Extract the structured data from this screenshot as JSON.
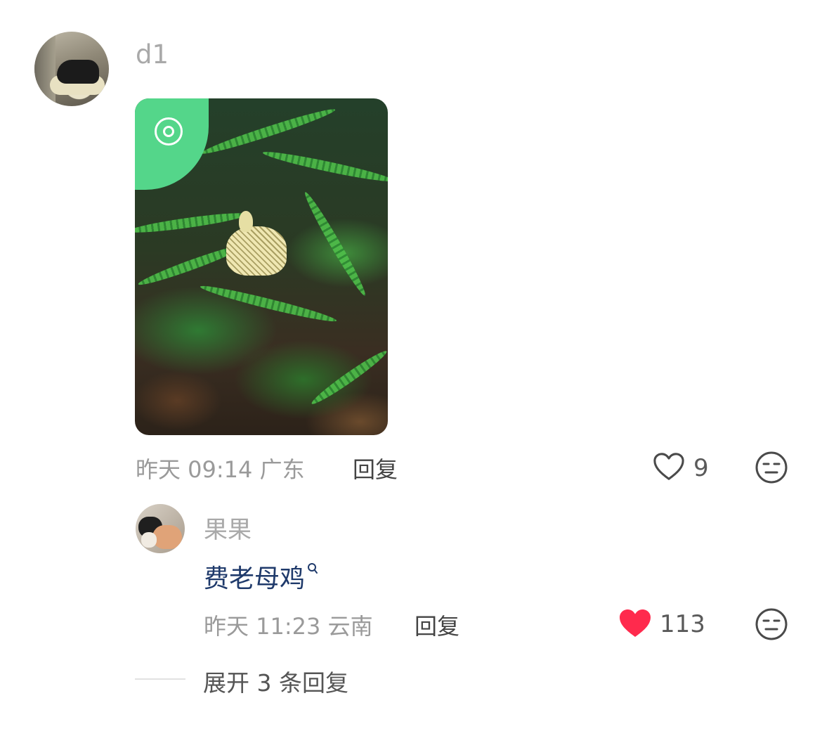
{
  "comment": {
    "username": "d1",
    "date": "昨天 09:14 广东",
    "reply_label": "回复",
    "likes": "9",
    "icons": {
      "like": "heart-outline-icon",
      "dislike": "meh-face-icon"
    }
  },
  "reply": {
    "username": "果果",
    "content": "费老母鸡",
    "date": "昨天 11:23 云南",
    "reply_label": "回复",
    "likes": "113",
    "liked": true,
    "heart_color": "#ff2a4d",
    "icons": {
      "like": "heart-filled-icon",
      "dislike": "meh-face-icon",
      "search": "search-icon"
    }
  },
  "expand": {
    "label": "展开 3 条回复"
  }
}
